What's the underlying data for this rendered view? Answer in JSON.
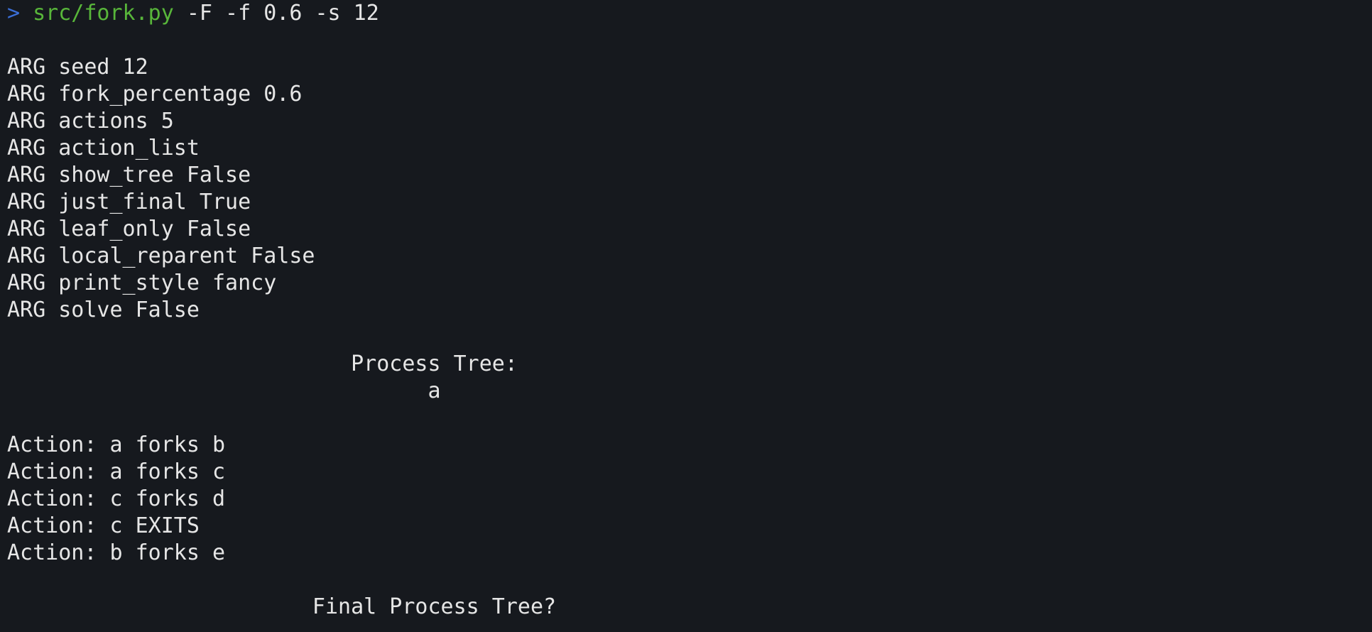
{
  "prompt": {
    "symbol": ">",
    "command": "src/fork.py",
    "args": "-F -f 0.6 -s 12"
  },
  "args_output": [
    "ARG seed 12",
    "ARG fork_percentage 0.6",
    "ARG actions 5",
    "ARG action_list",
    "ARG show_tree False",
    "ARG just_final True",
    "ARG leaf_only False",
    "ARG local_reparent False",
    "ARG print_style fancy",
    "ARG solve False"
  ],
  "process_tree": {
    "title": "Process Tree:",
    "root": "a"
  },
  "actions": [
    "Action: a forks b",
    "Action: a forks c",
    "Action: c forks d",
    "Action: c EXITS",
    "Action: b forks e"
  ],
  "final_tree": {
    "title": "Final Process Tree?"
  }
}
